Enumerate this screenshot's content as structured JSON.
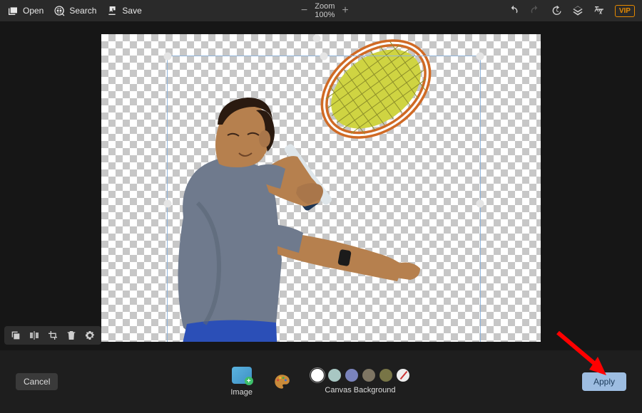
{
  "toolbar": {
    "open_label": "Open",
    "search_label": "Search",
    "save_label": "Save",
    "zoom_label": "Zoom",
    "zoom_value": "100%"
  },
  "mini_panel": {
    "tools": [
      "layers",
      "flip",
      "crop",
      "delete",
      "settings"
    ]
  },
  "bottom": {
    "cancel_label": "Cancel",
    "apply_label": "Apply",
    "image_opt_label": "Image",
    "canvas_bg_label": "Canvas Background"
  },
  "swatches": [
    "#ffffff",
    "#a8c7c3",
    "#7a83bc",
    "#7e7563",
    "#787546"
  ],
  "colors": {
    "accent": "#9dbde1",
    "arrow": "#ff0000"
  }
}
